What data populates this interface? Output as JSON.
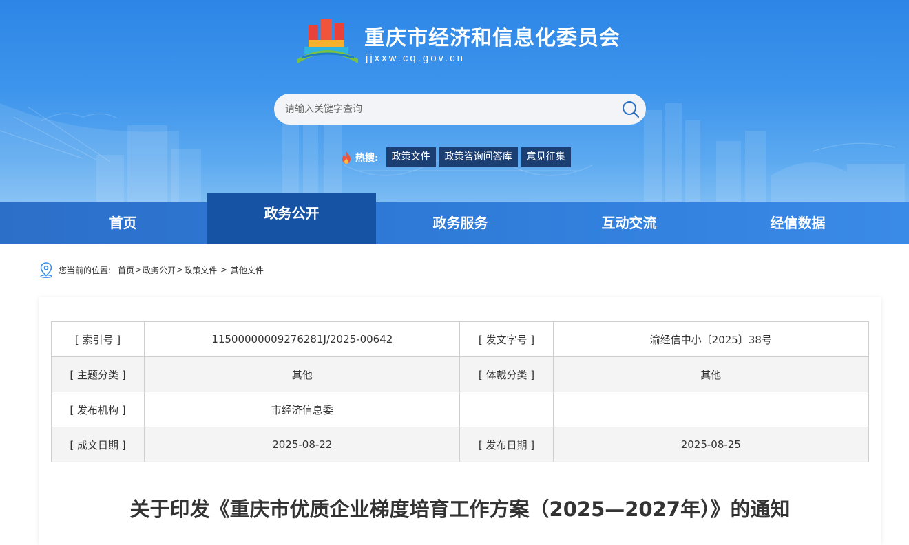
{
  "site": {
    "title": "重庆市经济和信息化委员会",
    "domain": "jjxxw.cq.gov.cn"
  },
  "search": {
    "placeholder": "请输入关键字查询"
  },
  "hot_search": {
    "label": "热搜:",
    "tags": [
      "政策文件",
      "政策咨询问答库",
      "意见征集"
    ]
  },
  "nav": {
    "items": [
      "首页",
      "政务公开",
      "政务服务",
      "互动交流",
      "经信数据"
    ],
    "active": "政务公开"
  },
  "breadcrumb": {
    "label": "您当前的位置:",
    "items": [
      "首页",
      "政务公开",
      "政策文件",
      "其他文件"
    ],
    "separators": [
      ">",
      ">",
      " > "
    ]
  },
  "meta": {
    "rows": [
      [
        "[ 索引号 ]",
        "11500000009276281J/2025-00642",
        "[ 发文字号 ]",
        "渝经信中小〔2025〕38号"
      ],
      [
        "[ 主题分类 ]",
        "其他",
        "[ 体裁分类 ]",
        "其他"
      ],
      [
        "[ 发布机构 ]",
        "市经济信息委",
        "",
        ""
      ],
      [
        "[ 成文日期 ]",
        "2025-08-22",
        "[ 发布日期 ]",
        "2025-08-25"
      ]
    ]
  },
  "document": {
    "title": "关于印发《重庆市优质企业梯度培育工作方案（2025—2027年）》的通知"
  },
  "colors": {
    "banner_top": "#2d86e6",
    "nav_active": "#1753a5",
    "hot_tag_bg": "#1b3e73"
  }
}
